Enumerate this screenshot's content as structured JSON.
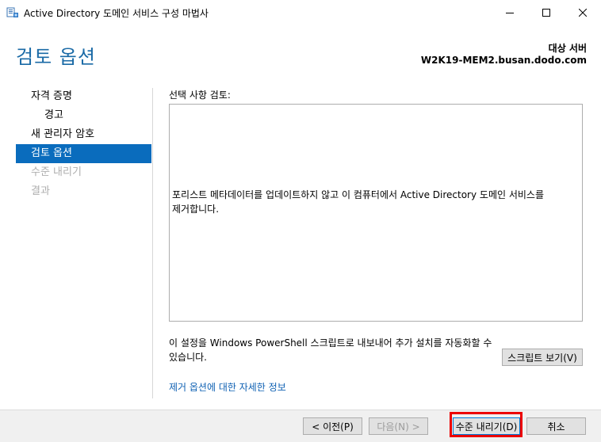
{
  "window": {
    "title": "Active Directory 도메인 서비스 구성 마법사",
    "controls": {
      "minimize": "—",
      "maximize": "☐",
      "close": "✕"
    }
  },
  "header": {
    "page_title": "검토 옵션",
    "target_label": "대상 서버",
    "target_server": "W2K19-MEM2.busan.dodo.com"
  },
  "nav": {
    "items": [
      {
        "label": "자격 증명",
        "state": "normal"
      },
      {
        "label": "경고",
        "state": "normal",
        "sub": true
      },
      {
        "label": "새 관리자 암호",
        "state": "normal"
      },
      {
        "label": "검토 옵션",
        "state": "active"
      },
      {
        "label": "수준 내리기",
        "state": "disabled"
      },
      {
        "label": "결과",
        "state": "disabled"
      }
    ]
  },
  "content": {
    "review_label": "선택 사항 검토:",
    "review_text": "포리스트 메타데이터를 업데이트하지 않고 이 컴퓨터에서 Active Directory 도메인 서비스를 제거합니다.",
    "powershell_text": "이 설정을 Windows PowerShell 스크립트로 내보내어 추가 설치를 자동화할 수 있습니다.",
    "view_script_button": "스크립트 보기(V)",
    "more_link": "제거 옵션에 대한 자세한 정보"
  },
  "footer": {
    "prev_button": "< 이전(P)",
    "next_button": "다음(N) >",
    "demote_button": "수준 내리기(D)",
    "cancel_button": "취소"
  },
  "colors": {
    "accent": "#0a6cbd",
    "title_blue": "#1a6aa6",
    "link_blue": "#0f61b3",
    "highlight_red": "#ec0000"
  }
}
